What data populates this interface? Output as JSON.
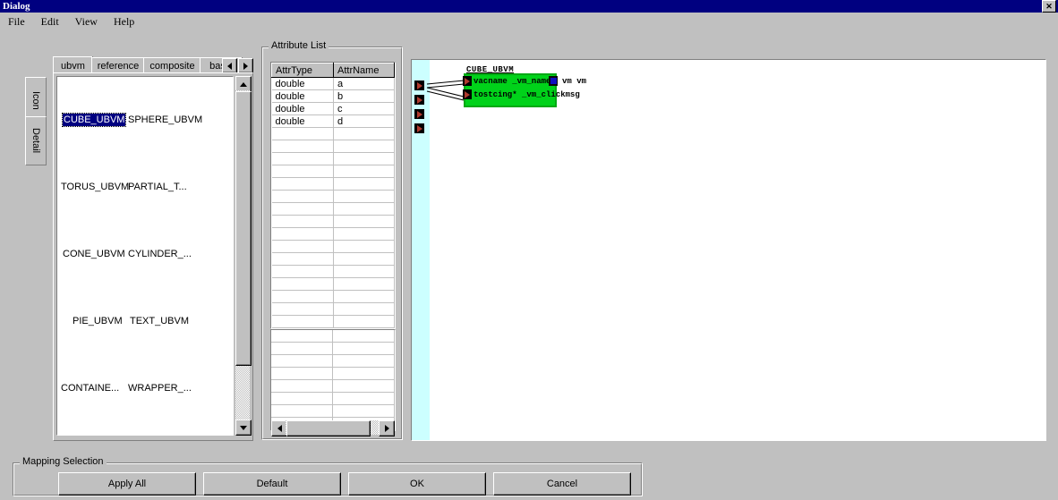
{
  "window": {
    "title": "Dialog",
    "close_label": "✕"
  },
  "menubar": {
    "items": [
      {
        "label": "File"
      },
      {
        "label": "Edit"
      },
      {
        "label": "View"
      },
      {
        "label": "Help"
      }
    ]
  },
  "side_tabs": {
    "items": [
      {
        "label": "Icon"
      },
      {
        "label": "Detail"
      }
    ]
  },
  "category_tabs": {
    "items": [
      {
        "label": "ubvm",
        "selected": true
      },
      {
        "label": "reference",
        "selected": false
      },
      {
        "label": "composite",
        "selected": false
      },
      {
        "label": "basic",
        "selected": false
      }
    ],
    "scroll_left_icon": "triangle-left-icon",
    "scroll_right_icon": "triangle-right-icon"
  },
  "icon_list": {
    "items": [
      {
        "label": "CUBE_UBVM",
        "selected": true
      },
      {
        "label": "SPHERE_UBVM",
        "selected": false
      },
      {
        "label": "TORUS_UBVM",
        "selected": false
      },
      {
        "label": "PARTIAL_T...",
        "selected": false
      },
      {
        "label": "CONE_UBVM",
        "selected": false
      },
      {
        "label": "CYLINDER_...",
        "selected": false
      },
      {
        "label": "PIE_UBVM",
        "selected": false
      },
      {
        "label": "TEXT_UBVM",
        "selected": false
      },
      {
        "label": "CONTAINE...",
        "selected": false
      },
      {
        "label": "WRAPPER_...",
        "selected": false
      }
    ]
  },
  "attribute_list": {
    "group_label": "Attribute List",
    "columns": [
      "AttrType",
      "AttrName"
    ],
    "rows": [
      {
        "type": "double",
        "name": "a"
      },
      {
        "type": "double",
        "name": "b"
      },
      {
        "type": "double",
        "name": "c"
      },
      {
        "type": "double",
        "name": "d"
      }
    ],
    "empty_row_count": 17,
    "lower_grid_row_count": 10
  },
  "diagram": {
    "node": {
      "title": "CUBE_UBVM",
      "rows": [
        {
          "text": "vacname  _vm_name"
        },
        {
          "text": "tostcing* _vm_clickmsg"
        }
      ],
      "output_label": "vm  vm"
    },
    "left_ports_count": 4,
    "colors": {
      "node_fill": "#00d21a",
      "strip": "#ccffff",
      "port_arrow": "#b03a2e",
      "output_port": "#1010c0"
    }
  },
  "mapping_selection": {
    "group_label": "Mapping Selection",
    "buttons": [
      {
        "label": "Apply All"
      },
      {
        "label": "Default"
      },
      {
        "label": "OK"
      },
      {
        "label": "Cancel"
      }
    ]
  }
}
